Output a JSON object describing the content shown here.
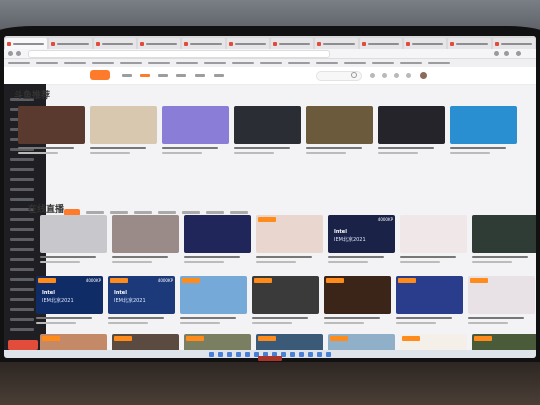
{
  "browser": {
    "tab_count": 12,
    "active_tab_index": 0
  },
  "site": {
    "accent_color": "#ff7b2c",
    "recommend_title": "斗鱼推荐",
    "live_title": "在线直播"
  },
  "tile_text": {
    "intel": "Intel",
    "iem": "IEM北京2021",
    "kp": "4000KP"
  },
  "recommend_thumbs": [
    "#5a3a2e",
    "#d9c8b0",
    "#8a7dd8",
    "#2b2d34",
    "#6b5a3b",
    "#24242a",
    "#2a8fd1"
  ],
  "live_rows": [
    [
      "#c8c8cc",
      "#9a8a88",
      "#20265a",
      "#e9d6cf",
      "#1a2347",
      "#f0e7e9",
      "#2f3b35"
    ],
    [
      "#0f2c66",
      "#1c3a7a",
      "#75a9d8",
      "#3a3a3a",
      "#3b2418",
      "#2a3c8c",
      "#e8e2e6"
    ],
    [
      "#c48a68",
      "#5a4a40",
      "#7a7f62",
      "#3a5a78",
      "#8fb0c8",
      "#f4efe9",
      "#4a5b3a"
    ]
  ]
}
